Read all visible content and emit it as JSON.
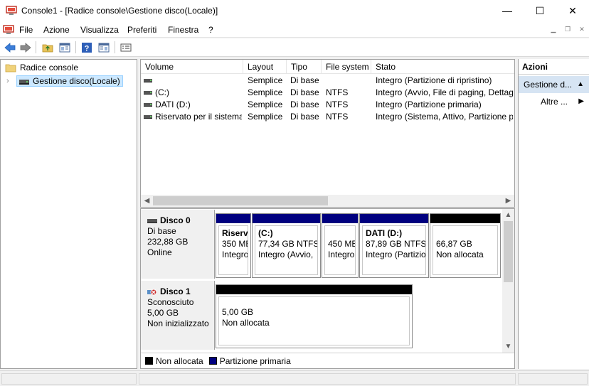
{
  "window": {
    "title": "Console1 - [Radice console\\Gestione disco(Locale)]",
    "minimize_glyph": "—",
    "maximize_glyph": "☐",
    "close_glyph": "✕"
  },
  "menu": [
    "File",
    "Azione",
    "Visualizza",
    "Preferiti",
    "Finestra",
    "?"
  ],
  "tree": {
    "root": "Radice console",
    "child": "Gestione disco(Locale)"
  },
  "list": {
    "headers": [
      "Volume",
      "Layout",
      "Tipo",
      "File system",
      "Stato"
    ],
    "rows": [
      {
        "volume": "",
        "layout": "Semplice",
        "tipo": "Di base",
        "fs": "",
        "stato": "Integro (Partizione di ripristino)"
      },
      {
        "volume": "(C:)",
        "layout": "Semplice",
        "tipo": "Di base",
        "fs": "NTFS",
        "stato": "Integro (Avvio, File di paging, Dettag"
      },
      {
        "volume": "DATI (D:)",
        "layout": "Semplice",
        "tipo": "Di base",
        "fs": "NTFS",
        "stato": "Integro (Partizione primaria)"
      },
      {
        "volume": "Riservato per il sistema",
        "layout": "Semplice",
        "tipo": "Di base",
        "fs": "NTFS",
        "stato": "Integro (Sistema, Attivo, Partizione pri"
      }
    ]
  },
  "disks": [
    {
      "name": "Disco 0",
      "type": "Di base",
      "size": "232,88 GB",
      "status": "Online",
      "partitions": [
        {
          "line1": "Riserv",
          "line2": "350 ME",
          "line3": "Integro",
          "kind": "primary"
        },
        {
          "line1": "(C:)",
          "line2": "77,34 GB NTFS",
          "line3": "Integro (Avvio,",
          "kind": "primary"
        },
        {
          "line1": "",
          "line2": "450 ME",
          "line3": "Integro",
          "kind": "primary"
        },
        {
          "line1": "DATI (D:)",
          "line2": "87,89 GB NTFS",
          "line3": "Integro (Partizio",
          "kind": "primary"
        },
        {
          "line1": "",
          "line2": "66,87 GB",
          "line3": "Non allocata",
          "kind": "unallocated"
        }
      ]
    },
    {
      "name": "Disco 1",
      "type": "Sconosciuto",
      "size": "5,00 GB",
      "status": "Non inizializzato",
      "partitions": [
        {
          "line1": "",
          "line2": "5,00 GB",
          "line3": "Non allocata",
          "kind": "unallocated"
        }
      ]
    }
  ],
  "legend": {
    "unallocated": "Non allocata",
    "primary": "Partizione primaria"
  },
  "actions": {
    "title": "Azioni",
    "section": "Gestione d...",
    "more": "Altre ..."
  },
  "colors": {
    "primary_partition": "#00007f",
    "unallocated": "#000000",
    "selection": "#cce8ff",
    "actions_section": "#d6e4f3"
  }
}
